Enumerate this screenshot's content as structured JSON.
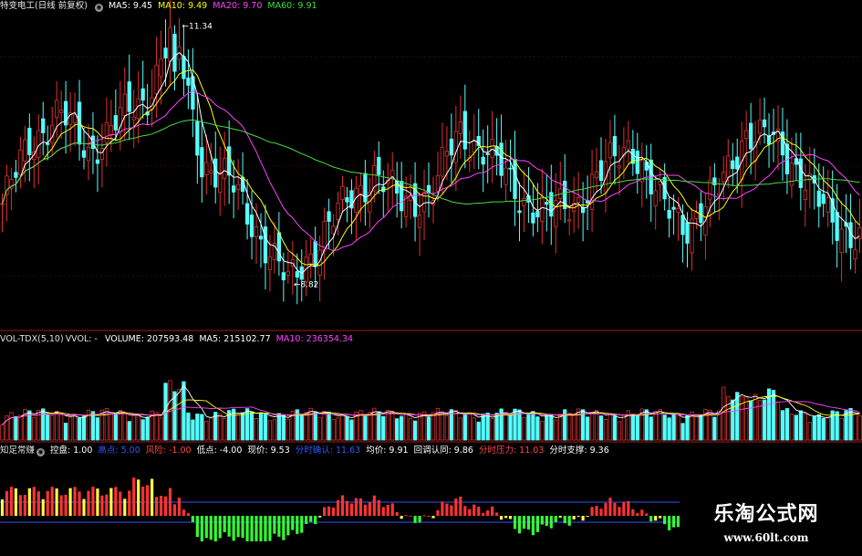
{
  "price_panel": {
    "title": "特变电工(日线 前复权)",
    "ma5": "MA5: 9.45",
    "ma10": "MA10: 9.49",
    "ma20": "MA20: 9.70",
    "ma60": "MA60: 9.91",
    "high_marker": "11.34",
    "low_marker": "8.82"
  },
  "volume_panel": {
    "title": "VOL-TDX(5,10)",
    "vvol": "VVOL: -",
    "volume": "VOLUME: 207593.48",
    "ma5": "MA5: 215102.77",
    "ma10": "MA10: 236354.34"
  },
  "indicator_panel": {
    "title": "知足常赚",
    "control": "控盘: 1.00",
    "high_point": "高点: 5.00",
    "risk": "风险: -1.00",
    "low_point": "低点: -4.00",
    "current_price": "现价: 9.53",
    "intraday_confirm": "分时确认: 11.63",
    "avg_price": "均价: 9.91",
    "pullback_confirm": "回调认同: 9.86",
    "intraday_pressure": "分时压力: 11.03",
    "intraday_support": "分时支撑: 9.36"
  },
  "watermark": {
    "title": "乐淘公式网",
    "url": "www.60lt.com"
  },
  "colors": {
    "up": "#e03030",
    "down": "#54ffff",
    "ma5": "#ffffff",
    "ma10": "#ffff00",
    "ma20": "#ff44ff",
    "ma60": "#44dd44",
    "ind_bar_up": "#ff3333",
    "ind_bar_yellow": "#ffff44",
    "ind_bar_green": "#33ff33",
    "level_line": "#3355ff"
  },
  "chart_data": {
    "type": "candlestick",
    "close_samples": [
      9.6,
      10.2,
      10.5,
      10.1,
      10.4,
      10.6,
      11.34,
      10.0,
      9.8,
      9.3,
      8.82,
      9.2,
      9.6,
      9.9,
      9.6,
      9.7,
      10.3,
      10.1,
      9.7,
      9.5,
      9.6,
      9.9,
      10.2,
      9.6,
      9.4,
      9.7,
      10.3,
      10.2,
      9.9,
      9.4,
      9.3
    ],
    "price_high": 11.34,
    "price_low": 8.82,
    "last_ma5": 9.45,
    "last_ma10": 9.49,
    "last_ma20": 9.7,
    "last_ma60": 9.91,
    "last_volume": 207593.48,
    "volume_ma5": 215102.77,
    "volume_ma10": 236354.34
  }
}
